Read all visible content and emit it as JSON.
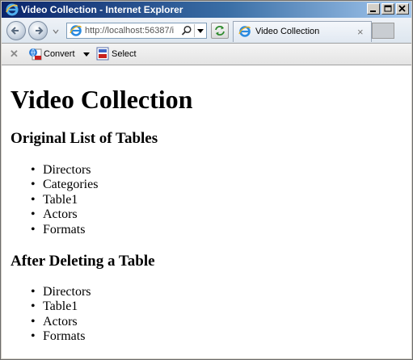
{
  "window": {
    "title": "Video Collection - Internet Explorer",
    "icon": "ie-logo-icon",
    "buttons": [
      "minimize-icon",
      "maximize-icon",
      "close-icon"
    ]
  },
  "navbar": {
    "back_icon": "back-arrow-icon",
    "forward_icon": "forward-arrow-icon",
    "address": {
      "value": "http://localhost:56387/i"
    },
    "tab": {
      "label": "Video Collection",
      "close_glyph": "×"
    }
  },
  "commandbar": {
    "convert_label": "Convert",
    "select_label": "Select"
  },
  "page": {
    "heading": "Video Collection",
    "section1": {
      "title": "Original List of Tables",
      "items": [
        "Directors",
        "Categories",
        "Table1",
        "Actors",
        "Formats"
      ]
    },
    "section2": {
      "title": "After Deleting a Table",
      "items": [
        "Directors",
        "Table1",
        "Actors",
        "Formats"
      ]
    }
  },
  "colors": {
    "titlebar_start": "#0a246a",
    "titlebar_end": "#a6caf0",
    "chrome": "#d4d0c8",
    "content_bg": "#ffffff"
  }
}
